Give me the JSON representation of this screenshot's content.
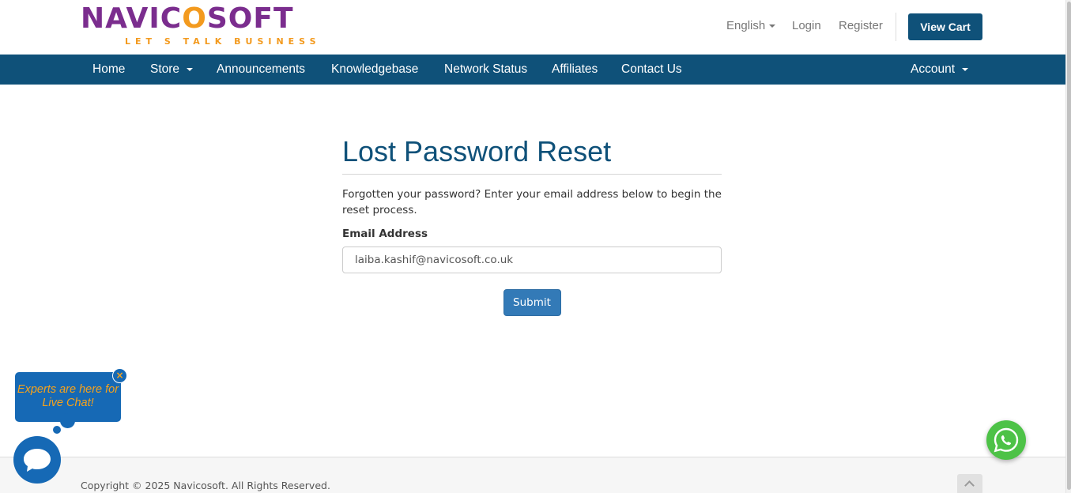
{
  "brand": {
    "logo_part1": "NAVIC",
    "logo_oo": "O",
    "logo_part2": "SOFT",
    "tagline": "LET S TALK BUSINESS",
    "colors": {
      "purple": "#7b2d8e",
      "orange": "#f39a1e",
      "navy": "#0f5179"
    }
  },
  "header": {
    "language": "English",
    "login": "Login",
    "register": "Register",
    "view_cart": "View Cart"
  },
  "nav": {
    "home": "Home",
    "store": "Store",
    "announcements": "Announcements",
    "knowledgebase": "Knowledgebase",
    "network_status": "Network Status",
    "affiliates": "Affiliates",
    "contact_us": "Contact Us",
    "account": "Account"
  },
  "main": {
    "title": "Lost Password Reset",
    "intro": "Forgotten your password? Enter your email address below to begin the reset process.",
    "email_label": "Email Address",
    "email_value": "laiba.kashif@navicosoft.co.uk",
    "submit": "Submit"
  },
  "footer": {
    "copyright": "Copyright © 2025 Navicosoft. All Rights Reserved."
  },
  "live_chat": {
    "bubble_text": "Experts are here for\nLive Chat!",
    "close_glyph": "×",
    "icon": "chat-bubble-icon"
  },
  "whatsapp": {
    "icon": "whatsapp-icon",
    "color": "#4dc247"
  }
}
